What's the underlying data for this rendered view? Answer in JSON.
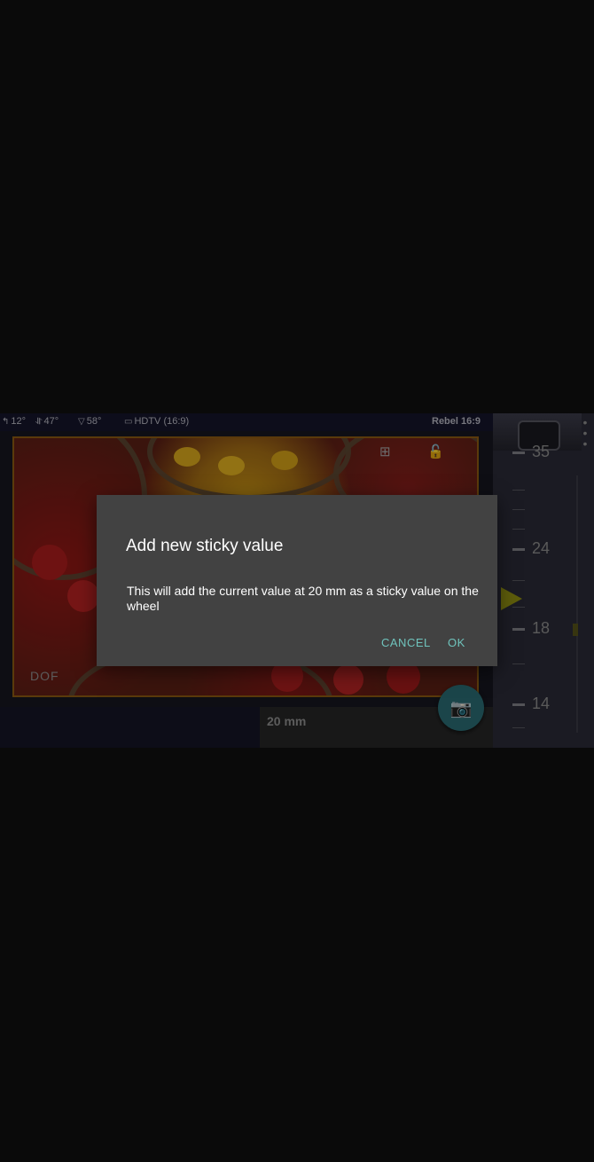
{
  "status": {
    "tilt": "12°",
    "roll": "47°",
    "fov": "58°",
    "format": "HDTV (16:9)",
    "camera": "Rebel 16:9"
  },
  "viewfinder": {
    "dof_label": "DOF"
  },
  "focal_length_readout": "20 mm",
  "wheel": {
    "labels": [
      "35",
      "24",
      "18",
      "14"
    ]
  },
  "dialog": {
    "title": "Add new sticky value",
    "message": "This will add the current value at 20 mm as a sticky value on the wheel",
    "cancel_label": "CANCEL",
    "ok_label": "OK"
  },
  "colors": {
    "accent": "#6fc3bc",
    "pointer": "#8f8e12",
    "frame": "#8a5a12"
  }
}
